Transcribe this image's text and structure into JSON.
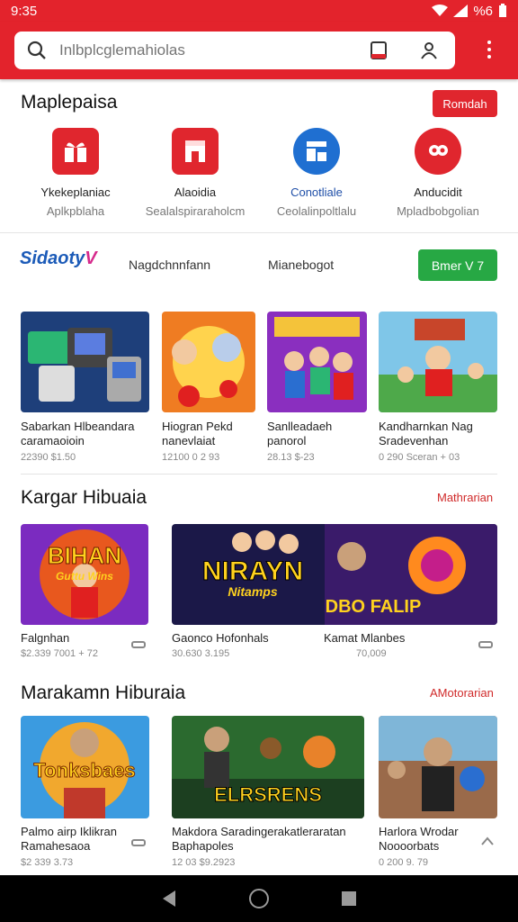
{
  "status": {
    "time": "9:35",
    "battery": "%6"
  },
  "search": {
    "placeholder": "Inlbplcglemahiolas"
  },
  "section1": {
    "title": "Maplepaisa",
    "button": "Romdah"
  },
  "categories": [
    {
      "name": "Ykekeplaniac",
      "sub": "Aplkpblaha",
      "color": "#e0262e",
      "icon": "gift-box-icon"
    },
    {
      "name": "Alaoidia",
      "sub": "Sealalspiraraholcm",
      "color": "#e0262e",
      "icon": "store-icon"
    },
    {
      "name": "Conotliale",
      "sub": "Ceolalinpoltlalu",
      "color": "#1f6fd1",
      "icon": "app-grid-icon"
    },
    {
      "name": "Anducidit",
      "sub": "Mpladbobgolian",
      "color": "#e0262e",
      "icon": "smile-face-icon"
    }
  ],
  "brand": {
    "name": "Sidaoty",
    "mark": "V",
    "nav1": "Nagdchnnfann",
    "nav2": "Mianebogot",
    "button": "Bmer V 7"
  },
  "row1": [
    {
      "title1": "Sabarkan Hlbeandara",
      "title2": "caramaoioin",
      "meta": "22390 $1.50"
    },
    {
      "title1": "Hiogran Pekd",
      "title2": "nanevlaiat",
      "meta": "12100 0 2 93"
    },
    {
      "title1": "Sanlleadaeh",
      "title2": "panorol",
      "meta": "28.13 $-23"
    },
    {
      "title1": "Kandharnkan Nag",
      "title2": "Sradevenhan",
      "meta": "0 290 Sceran + 03"
    }
  ],
  "section2": {
    "title": "Kargar Hibuaia",
    "more": "Mathrarian"
  },
  "row2": [
    {
      "art": "BIHAN",
      "art2": "Guttu Wins",
      "title": "Falgnhan",
      "meta": "$2.339 7001 + 72"
    },
    {
      "art": "NIRAYN",
      "art2": "Nitamps",
      "art3": "DBO FALIP",
      "title": "Gaonco Hofonhals",
      "meta": "30.630 3.195",
      "title2": "Kamat Mlanbes",
      "meta2": "70,009"
    }
  ],
  "section3": {
    "title": "Marakamn Hiburaia",
    "more": "AMotorarian"
  },
  "row3": [
    {
      "art": "Tonksbaes",
      "title1": "Palmo airp Iklikran",
      "title2": "Ramahesaoa",
      "meta": "$2 339 3.73"
    },
    {
      "art": "ELRSRENS",
      "title1": "Makdora Saradingerakatleraratan",
      "title2": "Baphapoles",
      "meta": "12 03 $9.2923"
    },
    {
      "title1": "Harlora Wrodar",
      "title2": "Noooorbats",
      "meta": "0 200 9. 79"
    }
  ]
}
